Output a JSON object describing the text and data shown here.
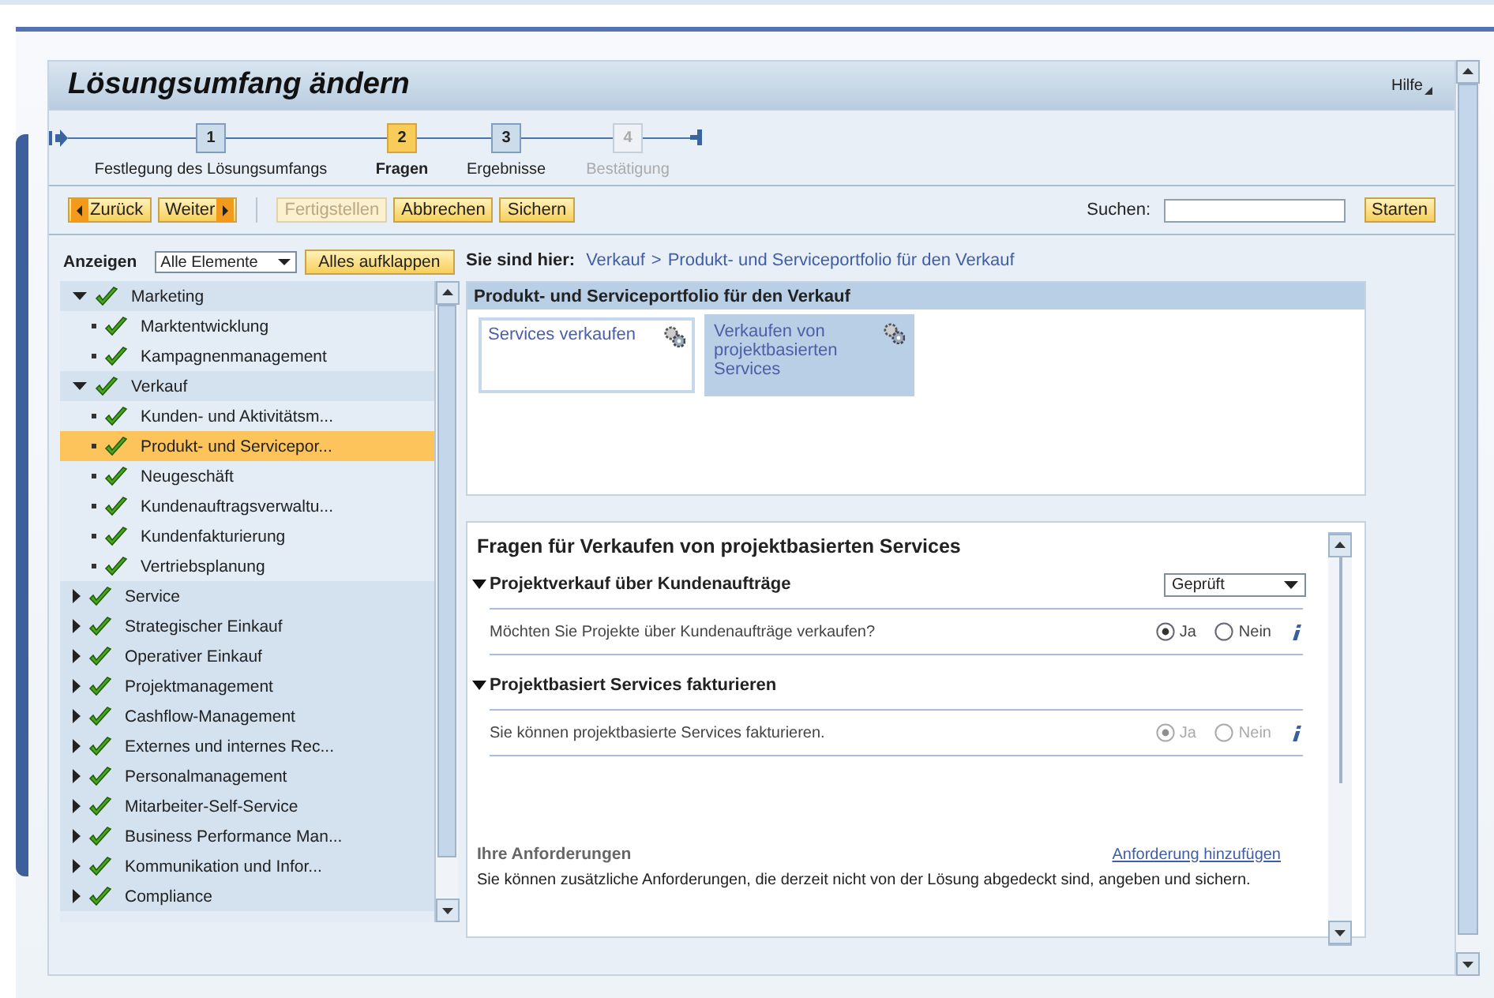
{
  "window": {
    "title": "Lösungsumfang ändern",
    "help": "Hilfe"
  },
  "roadmap": [
    {
      "number": "1",
      "label": "Festlegung des Lösungsumfangs",
      "selected": false,
      "disabled": false
    },
    {
      "number": "2",
      "label": "Fragen",
      "selected": true,
      "disabled": false
    },
    {
      "number": "3",
      "label": "Ergebnisse",
      "selected": false,
      "disabled": false
    },
    {
      "number": "4",
      "label": "Bestätigung",
      "selected": false,
      "disabled": true
    }
  ],
  "toolbar": {
    "buttons": [
      {
        "label": "Zurück",
        "kind": "back",
        "disabled": false
      },
      {
        "label": "Weiter",
        "kind": "next",
        "disabled": false
      },
      {
        "label": "Fertigstellen",
        "kind": "plain",
        "disabled": true
      },
      {
        "label": "Abbrechen",
        "kind": "plain",
        "disabled": false
      },
      {
        "label": "Sichern",
        "kind": "plain",
        "disabled": false
      }
    ],
    "search": {
      "label": "Suchen:",
      "button": "Starten"
    }
  },
  "filter": {
    "label": "Anzeigen",
    "dropdown": "Alle Elemente",
    "button": "Alles aufklappen"
  },
  "tree": [
    {
      "label": "Marketing",
      "checked": true,
      "expanded": true,
      "selected": false,
      "children": [
        {
          "label": "Marktentwicklung",
          "checked": true,
          "selected": false
        },
        {
          "label": "Kampagnenmanagement",
          "checked": true,
          "selected": false
        }
      ]
    },
    {
      "label": "Verkauf",
      "checked": true,
      "expanded": true,
      "selected": false,
      "children": [
        {
          "label": "Kunden- und Aktivitätsm...",
          "checked": true,
          "selected": false
        },
        {
          "label": "Produkt- und Servicepor...",
          "checked": true,
          "selected": true
        },
        {
          "label": "Neugeschäft",
          "checked": true,
          "selected": false
        },
        {
          "label": "Kundenauftragsverwaltu...",
          "checked": true,
          "selected": false
        },
        {
          "label": "Kundenfakturierung",
          "checked": true,
          "selected": false
        },
        {
          "label": "Vertriebsplanung",
          "checked": true,
          "selected": false
        }
      ]
    },
    {
      "label": "Service",
      "checked": true,
      "expanded": false,
      "selected": false
    },
    {
      "label": "Strategischer Einkauf",
      "checked": true,
      "expanded": false,
      "selected": false
    },
    {
      "label": "Operativer Einkauf",
      "checked": true,
      "expanded": false,
      "selected": false
    },
    {
      "label": "Projektmanagement",
      "checked": true,
      "expanded": false,
      "selected": false
    },
    {
      "label": "Cashflow-Management",
      "checked": true,
      "expanded": false,
      "selected": false
    },
    {
      "label": "Externes und internes Rec...",
      "checked": true,
      "expanded": false,
      "selected": false
    },
    {
      "label": "Personalmanagement",
      "checked": true,
      "expanded": false,
      "selected": false
    },
    {
      "label": "Mitarbeiter-Self-Service",
      "checked": true,
      "expanded": false,
      "selected": false
    },
    {
      "label": "Business Performance Man...",
      "checked": true,
      "expanded": false,
      "selected": false
    },
    {
      "label": "Kommunikation und Infor...",
      "checked": true,
      "expanded": false,
      "selected": false
    },
    {
      "label": "Compliance",
      "checked": true,
      "expanded": false,
      "selected": false
    }
  ],
  "breadcrumb": {
    "label": "Sie sind hier:",
    "path": [
      "Verkauf",
      "Produkt- und Serviceportfolio für den Verkauf"
    ],
    "separator": ">"
  },
  "portfolio": {
    "title": "Produkt- und Serviceportfolio für den Verkauf",
    "tiles": [
      {
        "label": "Services verkaufen",
        "selected": false
      },
      {
        "label": "Verkaufen von projektbasierten Services",
        "selected": true
      }
    ]
  },
  "questions": {
    "title": "Fragen für Verkaufen von projektbasierten Services",
    "groups": [
      {
        "title": "Projektverkauf über Kundenaufträge",
        "expanded": true,
        "status": "Geprüft",
        "items": [
          {
            "text": "Möchten Sie Projekte über Kundenaufträge verkaufen?",
            "disabled": false,
            "options": [
              {
                "label": "Ja",
                "selected": true
              },
              {
                "label": "Nein",
                "selected": false
              }
            ]
          }
        ]
      },
      {
        "title": "Projektbasiert Services fakturieren",
        "expanded": true,
        "items": [
          {
            "text": "Sie können projektbasierte Services fakturieren.",
            "disabled": true,
            "options": [
              {
                "label": "Ja",
                "selected": true
              },
              {
                "label": "Nein",
                "selected": false
              }
            ]
          }
        ]
      }
    ],
    "requirements": {
      "title": "Ihre Anforderungen",
      "link": "Anforderung hinzufügen",
      "text": "Sie können zusätzliche Anforderungen, die derzeit nicht von der Lösung abgedeckt sind, angeben und sichern."
    }
  }
}
